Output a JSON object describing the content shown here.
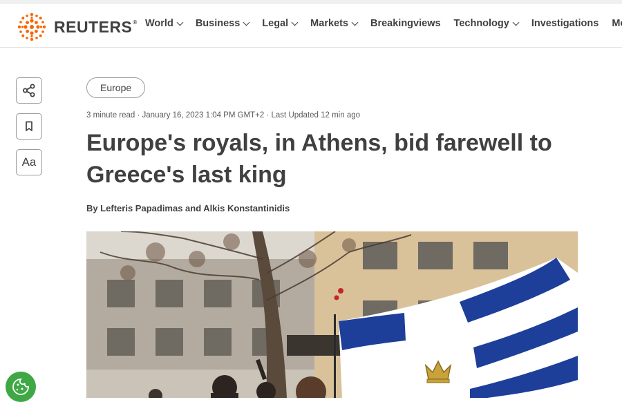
{
  "header": {
    "logo_text": "REUTERS",
    "logo_reg": "®",
    "nav": [
      {
        "label": "World",
        "has_dropdown": true
      },
      {
        "label": "Business",
        "has_dropdown": true
      },
      {
        "label": "Legal",
        "has_dropdown": true
      },
      {
        "label": "Markets",
        "has_dropdown": true
      },
      {
        "label": "Breakingviews",
        "has_dropdown": false
      },
      {
        "label": "Technology",
        "has_dropdown": true
      },
      {
        "label": "Investigations",
        "has_dropdown": false
      },
      {
        "label": "More",
        "has_dropdown": true
      }
    ]
  },
  "sidebar": {
    "share_icon": "share-icon",
    "bookmark_icon": "bookmark-icon",
    "font_size_label": "Aa"
  },
  "article": {
    "tag": "Europe",
    "meta": "3 minute read · January 16, 2023 1:04 PM GMT+2 · Last Updated 12 min ago",
    "title": "Europe's royals, in Athens, bid farewell to Greece's last king",
    "byline": "By Lefteris Papadimas and Alkis Konstantinidis"
  },
  "colors": {
    "brand_orange": "#fa6400",
    "text": "#404040",
    "flag_blue": "#1d3f9a",
    "cookie_green": "#3fa845"
  }
}
